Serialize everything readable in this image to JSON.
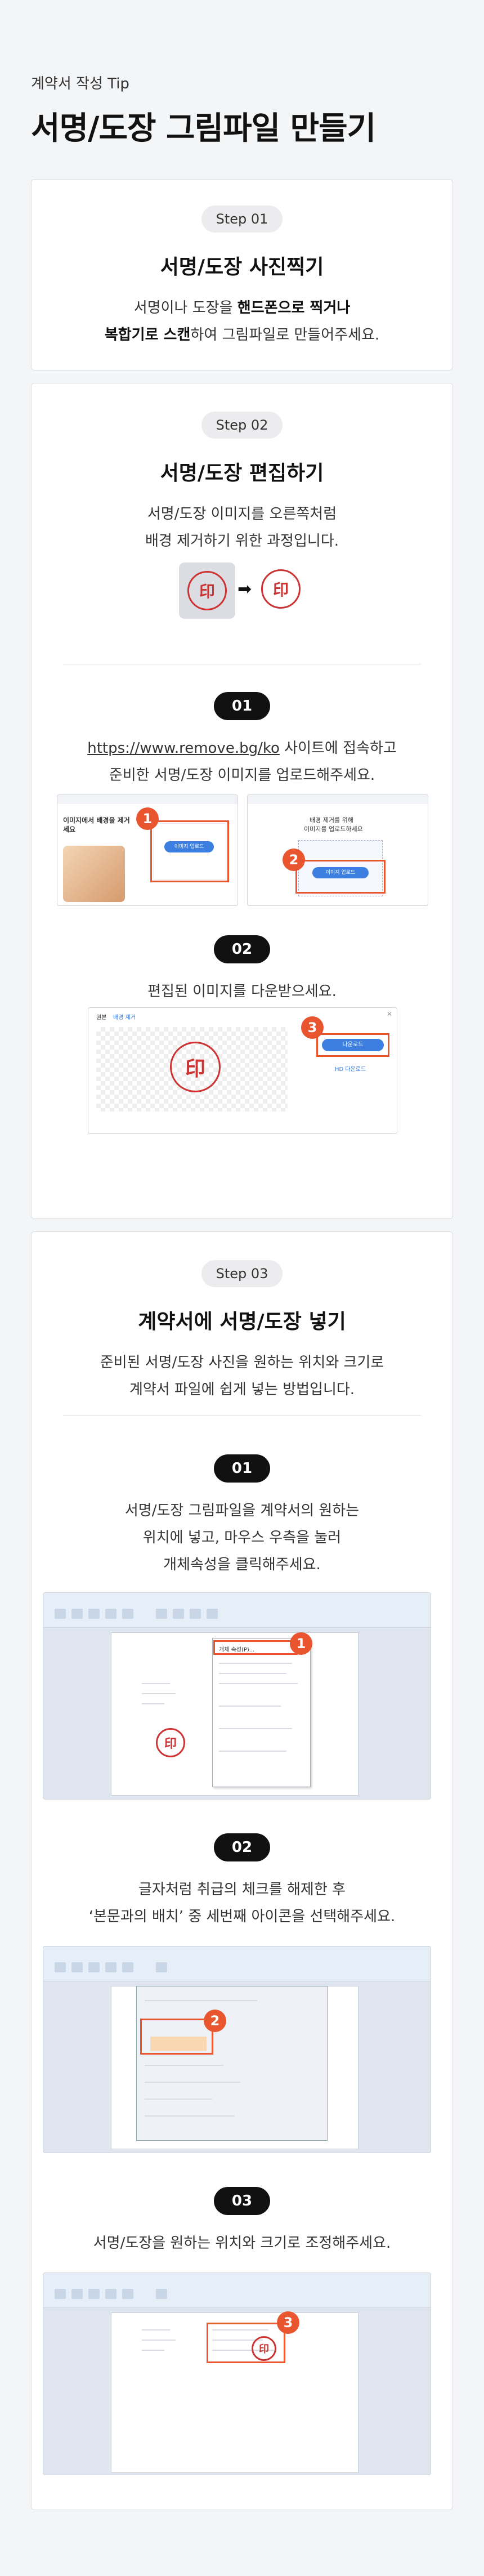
{
  "header": {
    "subtitle": "계약서 작성 Tip",
    "title": "서명/도장 그림파일 만들기"
  },
  "step1": {
    "pill": "Step 01",
    "heading": "서명/도장 사진찍기",
    "line1_a": "서명이나 도장을 ",
    "line1_b": "핸드폰으로 찍거나",
    "line2_a": "복합기로 스캔",
    "line2_b": "하여 그림파일로 만들어주세요."
  },
  "step2": {
    "pill": "Step 02",
    "heading": "서명/도장 편집하기",
    "line1": "서명/도장 이미지를 오른쪽처럼",
    "line2": "배경 제거하기 위한 과정입니다.",
    "arrow": "➡",
    "sub1": {
      "num": "01",
      "link": "https://www.remove.bg/ko",
      "line1_rest": " 사이트에 접속하고",
      "line2": "준비한 서명/도장 이미지를 업로드해주세요.",
      "shotA_text1": "이미지에서 배경을 제거",
      "shotA_text2": "세요",
      "shotA_btn": "이미지 업로드",
      "shotB_text1": "배경 제거를 위해",
      "shotB_text2": "이미지를 업로드하세요",
      "shotB_btn": "이미지 업로드",
      "badge1": "1",
      "badge2": "2"
    },
    "sub2": {
      "num": "02",
      "line1": "편집된 이미지를 다운받으세요.",
      "tab1": "원본",
      "tab2": "배경 제거",
      "btn": "다운로드",
      "btn2": "HD 다운로드",
      "badge3": "3"
    }
  },
  "step3": {
    "pill": "Step 03",
    "heading": "계약서에 서명/도장 넣기",
    "line1": "준비된 서명/도장 사진을 원하는 위치와 크기로",
    "line2": "계약서 파일에 쉽게 넣는 방법입니다.",
    "sub1": {
      "num": "01",
      "line1": "서명/도장 그림파일을 계약서의 원하는",
      "line2": "위치에 넣고, 마우스 우측을 눌러",
      "line3": "개체속성을 클릭해주세요.",
      "menu_item": "개체 속성(P)...",
      "badge": "1"
    },
    "sub2": {
      "num": "02",
      "line1": "글자처럼 취급의 체크를 해제한 후",
      "line2": "‘본문과의 배치’ 중 세번째 아이콘을 선택해주세요.",
      "badge": "2"
    },
    "sub3": {
      "num": "03",
      "line1": "서명/도장을 원하는 위치와 크기로 조정해주세요.",
      "badge": "3"
    }
  },
  "stamp_text": "印",
  "colors": {
    "accent": "#e8552f",
    "stamp": "#cc3333",
    "ui_blue": "#3d7fe0"
  }
}
